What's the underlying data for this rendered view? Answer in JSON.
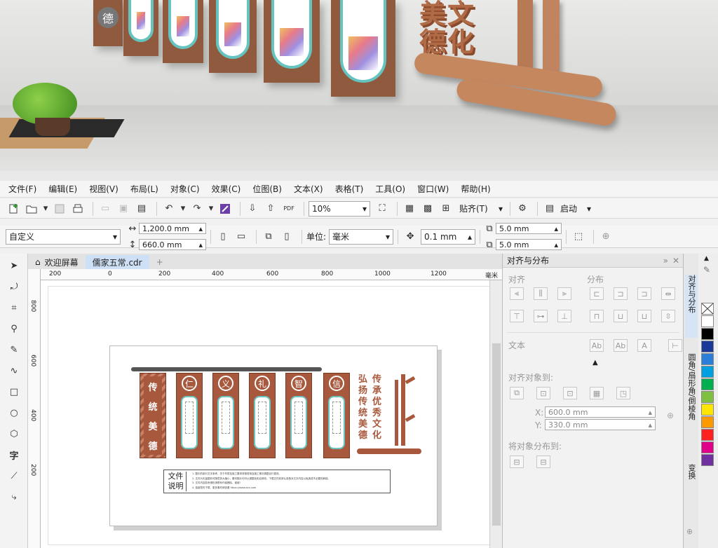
{
  "render": {
    "pillar_chars": [
      "仁",
      "义",
      "礼",
      "智",
      "信"
    ],
    "banner": "美文德化",
    "logo_char": "德"
  },
  "menubar": {
    "items": [
      "文件(F)",
      "编辑(E)",
      "视图(V)",
      "布局(L)",
      "对象(C)",
      "效果(C)",
      "位图(B)",
      "文本(X)",
      "表格(T)",
      "工具(O)",
      "窗口(W)",
      "帮助(H)"
    ]
  },
  "toolbar1": {
    "zoom": "10%",
    "snap_label": "贴齐(T)",
    "launch_label": "启动",
    "pdf_label": "PDF"
  },
  "toolbar2": {
    "preset": "自定义",
    "width": "1,200.0 mm",
    "height": "660.0 mm",
    "unit_label": "单位:",
    "unit": "毫米",
    "nudge": "0.1 mm",
    "dup_x": "5.0 mm",
    "dup_y": "5.0 mm"
  },
  "tabs": [
    {
      "label": "欢迎屏幕"
    },
    {
      "label": "儒家五常.cdr"
    }
  ],
  "ruler": {
    "top_ticks": [
      "200",
      "0",
      "200",
      "400",
      "600",
      "800",
      "1000",
      "1200",
      "毫米"
    ],
    "left_ticks": [
      "800",
      "600",
      "400",
      "200"
    ]
  },
  "design": {
    "pillar_left": [
      "传",
      "统",
      "美",
      "德"
    ],
    "pillars": [
      "仁",
      "义",
      "礼",
      "智",
      "信"
    ],
    "slogan_col1": "弘扬传统美德",
    "slogan_col2": "传承优秀文化",
    "note_title": "文件说明",
    "note_lines": [
      "1. 图中的部分文字参考，关于材质及施工要求请按现场及施工情况调整自行更改。",
      "2. 文件为矢量图形可随意放大缩小，素材图片均可以调整色彩后修改，下载文件前请认真核对文字内容以免造成不必要的麻烦。",
      "3. 文件内容若有侵权请联系作者删除，谢谢！",
      "4. 感谢您的下载，更多素材请查看  https://www.xxx.com"
    ]
  },
  "docker": {
    "title": "对齐与分布",
    "align_label": "对齐",
    "distribute_label": "分布",
    "text_label": "文本",
    "align_to_label": "对齐对象到:",
    "x_label": "X:",
    "x_value": "600.0 mm",
    "y_label": "Y:",
    "y_value": "330.0 mm",
    "distribute_to_label": "将对象分布到:"
  },
  "vertical_tabs": [
    "对齐与分布",
    "圆角/扇形角/倒棱角",
    "变换"
  ],
  "palette": [
    "#ffffff",
    "#000000",
    "#1a3a9a",
    "#2b7fd8",
    "#00a0e0",
    "#00b050",
    "#80c040",
    "#ffe600",
    "#ff9900",
    "#ff2020",
    "#e0008a",
    "#7030a0"
  ]
}
